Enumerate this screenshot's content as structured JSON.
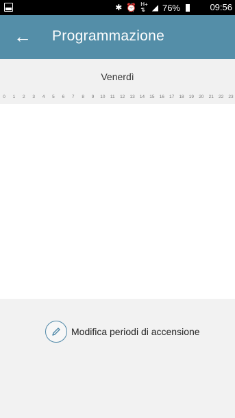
{
  "status_bar": {
    "icons": [
      "bluetooth-icon",
      "alarm-icon",
      "hplus-signal-icon",
      "signal-icon",
      "battery-icon"
    ],
    "battery_percent": "76%",
    "time": "09:56"
  },
  "app_bar": {
    "back_icon": "arrow-left-icon",
    "title": "Programmazione",
    "color": "#548ea8"
  },
  "day": {
    "label": "Venerdì",
    "hours": [
      "0",
      "1",
      "2",
      "3",
      "4",
      "5",
      "6",
      "7",
      "8",
      "9",
      "10",
      "11",
      "12",
      "13",
      "14",
      "15",
      "16",
      "17",
      "18",
      "19",
      "20",
      "21",
      "22",
      "23"
    ]
  },
  "action": {
    "icon": "pencil-icon",
    "label": "Modifica periodi di accensione"
  }
}
